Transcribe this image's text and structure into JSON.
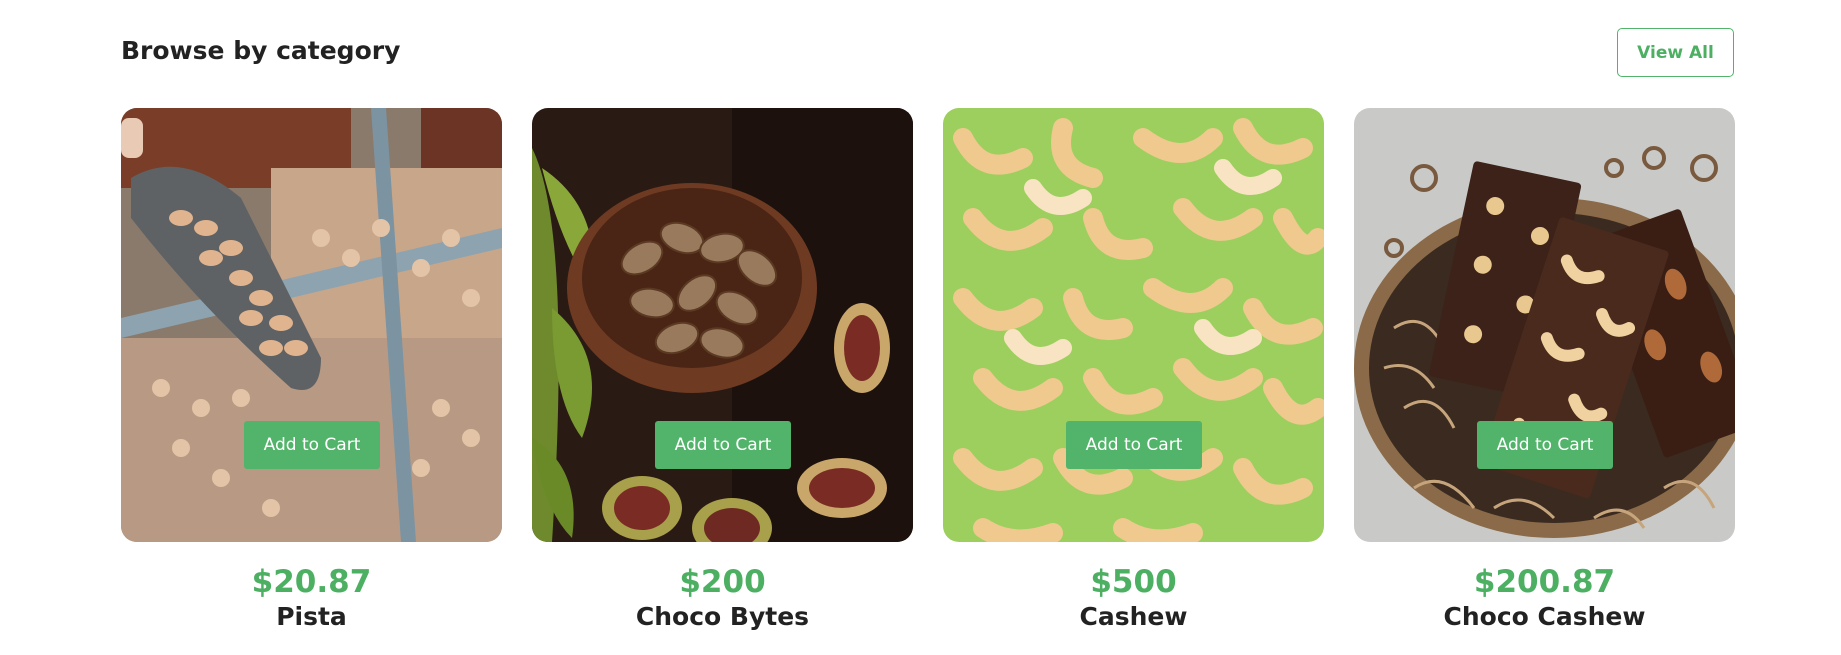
{
  "section": {
    "title": "Browse by category",
    "view_all_label": "View All"
  },
  "colors": {
    "accent": "#52b46a",
    "price": "#4caf62",
    "text": "#222222"
  },
  "products": [
    {
      "name": "Pista",
      "price": "$20.87",
      "button_label": "Add to Cart",
      "image": "pistachio-scoop-image"
    },
    {
      "name": "Choco Bytes",
      "price": "$200",
      "button_label": "Add to Cart",
      "image": "almond-bowl-figs-image"
    },
    {
      "name": "Cashew",
      "price": "$500",
      "button_label": "Add to Cart",
      "image": "cashews-on-green-image"
    },
    {
      "name": "Choco Cashew",
      "price": "$200.87",
      "button_label": "Add to Cart",
      "image": "chocolate-bars-basket-image"
    }
  ]
}
